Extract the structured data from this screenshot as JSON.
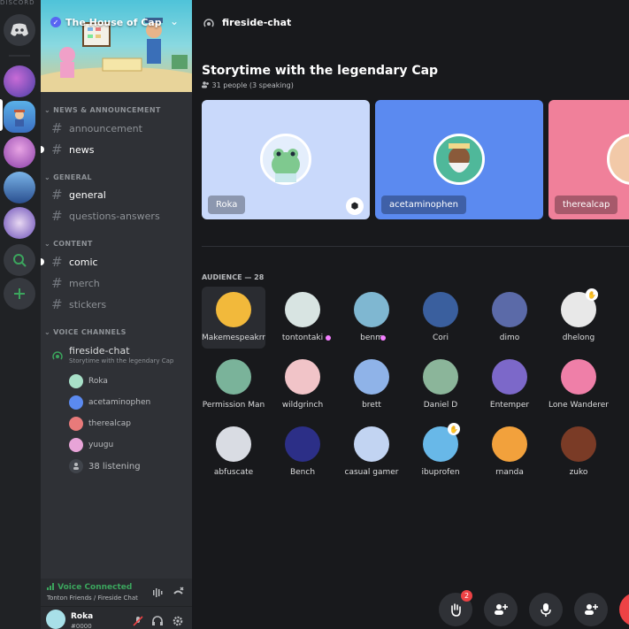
{
  "rail": {
    "top_label": "DISCORD",
    "servers": [
      "server-1",
      "the-house-of-cap",
      "server-3",
      "server-4",
      "server-5"
    ]
  },
  "server": {
    "name": "The House of Cap"
  },
  "categories": [
    {
      "name": "NEWS & ANNOUNCEMENT",
      "channels": [
        {
          "name": "announcement",
          "unread": false
        },
        {
          "name": "news",
          "unread": true
        }
      ]
    },
    {
      "name": "GENERAL",
      "channels": [
        {
          "name": "general",
          "unread": true
        },
        {
          "name": "questions-answers",
          "unread": false
        }
      ]
    },
    {
      "name": "CONTENT",
      "channels": [
        {
          "name": "comic",
          "unread": true
        },
        {
          "name": "merch",
          "unread": false
        },
        {
          "name": "stickers",
          "unread": false
        }
      ]
    }
  ],
  "voice_category": "VOICE CHANNELS",
  "voice_channel": {
    "name": "fireside-chat",
    "topic": "Storytime with the legendary Cap",
    "users": [
      "Roka",
      "acetaminophen",
      "therealcap",
      "yuugu"
    ],
    "listening": "38 listening"
  },
  "voice_bar": {
    "status": "Voice Connected",
    "location": "Tonton Friends / Fireside Chat"
  },
  "user": {
    "name": "Roka",
    "tag": "#0000"
  },
  "main": {
    "channel": "fireside-chat",
    "stage_title": "Storytime with the legendary Cap",
    "stage_sub": "31 people (3 speaking)",
    "speakers": [
      {
        "name": "Roka",
        "bg": "#c9d9fb",
        "badge": "shield-icon"
      },
      {
        "name": "acetaminophen",
        "bg": "#5b8af0"
      },
      {
        "name": "therealcap",
        "bg": "#f0809a"
      }
    ],
    "audience_title": "AUDIENCE — 28",
    "audience": [
      {
        "name": "Makemespeakrr",
        "color": "#f2b93b",
        "selected": true
      },
      {
        "name": "tontontaki",
        "color": "#d8e4e2",
        "boost": true
      },
      {
        "name": "benm",
        "color": "#7fb7d1",
        "boost": true
      },
      {
        "name": "Cori",
        "color": "#3a5f9e"
      },
      {
        "name": "dimo",
        "color": "#5b6aa8"
      },
      {
        "name": "dhelong",
        "color": "#e8e8e8",
        "hand": true
      },
      {
        "name": "Permission Man",
        "color": "#7ab39a"
      },
      {
        "name": "wildgrinch",
        "color": "#f1c4c8"
      },
      {
        "name": "brett",
        "color": "#8fb3e8"
      },
      {
        "name": "Daniel D",
        "color": "#8bb59a"
      },
      {
        "name": "Entemper",
        "color": "#7c68c9"
      },
      {
        "name": "Lone Wanderer",
        "color": "#ef7fa8"
      },
      {
        "name": "abfuscate",
        "color": "#d9dce3"
      },
      {
        "name": "Bench",
        "color": "#2c2f87"
      },
      {
        "name": "casual gamer",
        "color": "#c2d4f2"
      },
      {
        "name": "ibuprofen",
        "color": "#68b8e8",
        "hand": true
      },
      {
        "name": "rnanda",
        "color": "#f2a13c"
      },
      {
        "name": "zuko",
        "color": "#7a3b26"
      }
    ],
    "hand_count": "2"
  }
}
